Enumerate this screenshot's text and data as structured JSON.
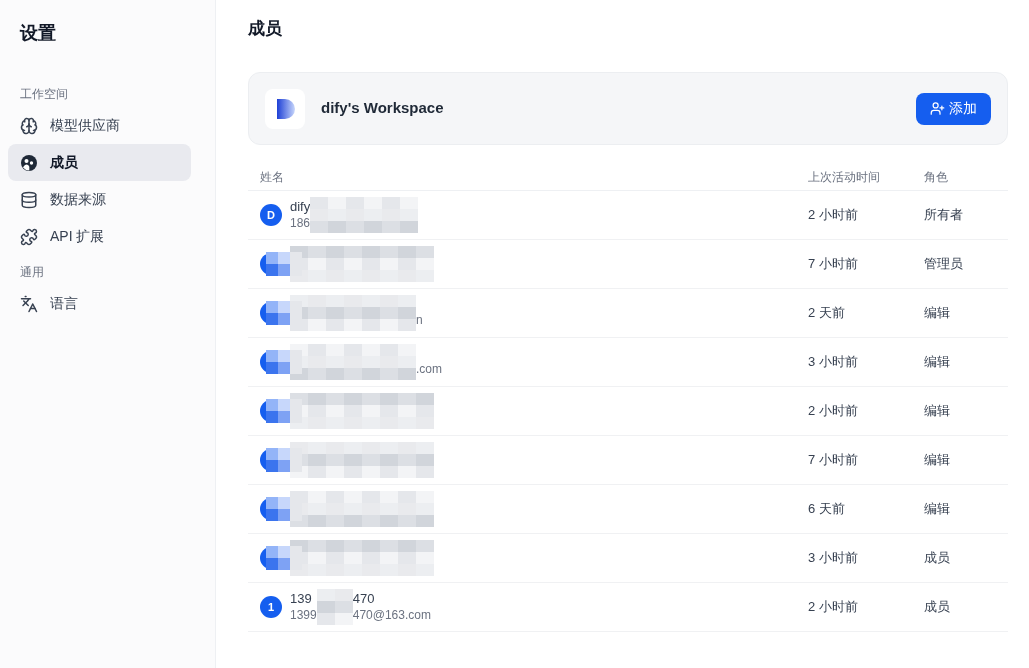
{
  "sidebar": {
    "title": "设置",
    "groups": [
      {
        "label": "工作空间",
        "items": [
          {
            "kind": "brain",
            "label": "模型供应商",
            "selected": false
          },
          {
            "kind": "members",
            "label": "成员",
            "selected": true
          },
          {
            "kind": "database",
            "label": "数据来源",
            "selected": false
          },
          {
            "kind": "puzzle",
            "label": "API 扩展",
            "selected": false
          }
        ]
      },
      {
        "label": "通用",
        "items": [
          {
            "kind": "language",
            "label": "语言",
            "selected": false
          }
        ]
      }
    ]
  },
  "page_title": "成员",
  "workspace": {
    "name": "dify's Workspace",
    "add_button": "添加"
  },
  "table": {
    "columns": [
      "姓名",
      "上次活动时间",
      "角色"
    ],
    "rows": [
      {
        "avatar": "D",
        "segments": [
          {
            "name": "dify",
            "email": "186"
          }
        ],
        "last_active": "2 小时前",
        "role": "所有者"
      },
      {
        "last_active": "7 小时前",
        "role": "管理员"
      },
      {
        "email_tail": "n",
        "last_active": "2 天前",
        "role": "编辑"
      },
      {
        "email_tail": ".com",
        "last_active": "3 小时前",
        "role": "编辑"
      },
      {
        "last_active": "2 小时前",
        "role": "编辑"
      },
      {
        "last_active": "7 小时前",
        "role": "编辑"
      },
      {
        "last_active": "6 天前",
        "role": "编辑"
      },
      {
        "last_active": "3 小时前",
        "role": "成员"
      },
      {
        "avatar": "1",
        "segments": [
          {
            "name": "139",
            "email": "1399"
          },
          {
            "name": "470",
            "email": "470@163.com"
          }
        ],
        "last_active": "2 小时前",
        "role": "成员"
      }
    ]
  }
}
